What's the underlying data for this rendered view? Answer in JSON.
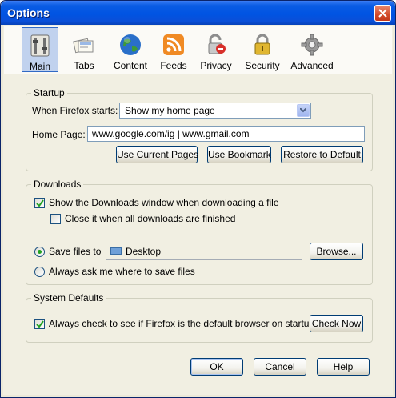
{
  "window": {
    "title": "Options"
  },
  "toolbar": {
    "items": [
      {
        "label": "Main",
        "icon": "main-switch-icon",
        "selected": true
      },
      {
        "label": "Tabs",
        "icon": "tabs-icon",
        "selected": false
      },
      {
        "label": "Content",
        "icon": "globe-icon",
        "selected": false
      },
      {
        "label": "Feeds",
        "icon": "rss-feed-icon",
        "selected": false
      },
      {
        "label": "Privacy",
        "icon": "privacy-lock-icon",
        "selected": false
      },
      {
        "label": "Security",
        "icon": "padlock-icon",
        "selected": false
      },
      {
        "label": "Advanced",
        "icon": "gear-icon",
        "selected": false
      }
    ]
  },
  "startup": {
    "group_label": "Startup",
    "when_starts_label": "When Firefox starts:",
    "when_starts_value": "Show my home page",
    "home_page_label": "Home Page:",
    "home_page_value": "www.google.com/ig | www.gmail.com",
    "use_current_pages": "Use Current Pages",
    "use_bookmark": "Use Bookmark",
    "restore_default": "Restore to Default"
  },
  "downloads": {
    "group_label": "Downloads",
    "show_window_label": "Show the Downloads window when downloading a file",
    "show_window_checked": true,
    "close_when_done_label": "Close it when all downloads are finished",
    "close_when_done_checked": false,
    "save_files_label": "Save files to",
    "save_files_selected": true,
    "save_location": "Desktop",
    "browse_label": "Browse...",
    "always_ask_label": "Always ask me where to save files",
    "always_ask_selected": false
  },
  "system_defaults": {
    "group_label": "System Defaults",
    "always_check_label": "Always check to see if Firefox is the default browser on startup",
    "always_check_checked": true,
    "check_now_label": "Check Now"
  },
  "footer": {
    "ok_label": "OK",
    "cancel_label": "Cancel",
    "help_label": "Help"
  },
  "colors": {
    "titlebar": "#0054e3",
    "dialog_bg": "#f1efe2",
    "selected_tab": "#c1d2ee",
    "radio_dot": "#21a121"
  }
}
